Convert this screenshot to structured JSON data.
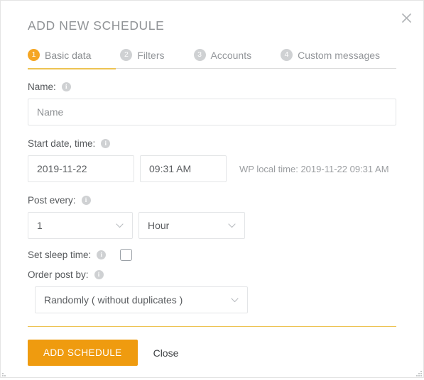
{
  "modal": {
    "title": "ADD NEW SCHEDULE",
    "close_icon": "close-icon",
    "accent_color": "#ef9b0f",
    "rule_color": "#edc352"
  },
  "tabs": [
    {
      "number": "1",
      "label": "Basic data",
      "active": true
    },
    {
      "number": "2",
      "label": "Filters",
      "active": false
    },
    {
      "number": "3",
      "label": "Accounts",
      "active": false
    },
    {
      "number": "4",
      "label": "Custom messages",
      "active": false
    }
  ],
  "form": {
    "name": {
      "label": "Name:",
      "info_icon": "info-icon",
      "value": "",
      "placeholder": "Name"
    },
    "start": {
      "label": "Start date, time:",
      "info_icon": "info-icon",
      "date_value": "2019-11-22",
      "time_value": "09:31 AM",
      "local_time_note": "WP local time: 2019-11-22 09:31 AM"
    },
    "post_every": {
      "label": "Post every:",
      "info_icon": "info-icon",
      "count_value": "1",
      "unit_value": "Hour",
      "chevron_icon": "chevron-down-icon"
    },
    "sleep_time": {
      "label": "Set sleep time:",
      "info_icon": "info-icon",
      "checked": false
    },
    "order_post_by": {
      "label": "Order post by:",
      "info_icon": "info-icon",
      "value": "Randomly ( without duplicates )",
      "chevron_icon": "chevron-down-icon"
    }
  },
  "footer": {
    "submit_label": "ADD SCHEDULE",
    "close_label": "Close"
  }
}
